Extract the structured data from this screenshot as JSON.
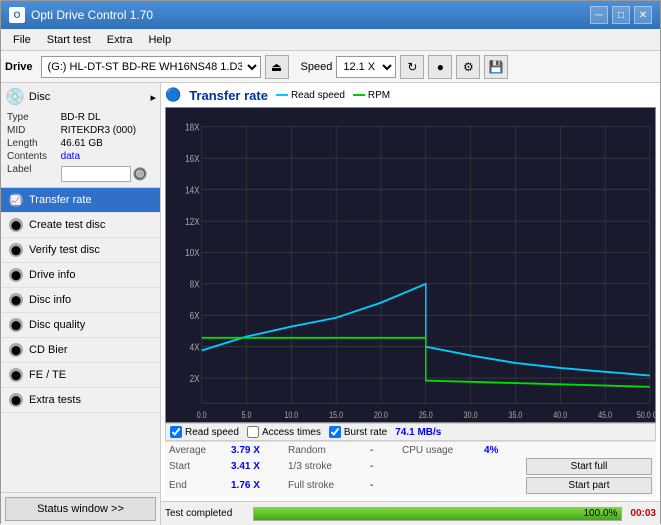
{
  "titlebar": {
    "title": "Opti Drive Control 1.70",
    "min_label": "─",
    "max_label": "□",
    "close_label": "✕"
  },
  "menubar": {
    "items": [
      "File",
      "Start test",
      "Extra",
      "Help"
    ]
  },
  "toolbar": {
    "drive_label": "Drive",
    "drive_value": "(G:)  HL-DT-ST BD-RE  WH16NS48 1.D3",
    "speed_label": "Speed",
    "speed_value": "12.1 X"
  },
  "disc": {
    "type_label": "Type",
    "type_value": "BD-R DL",
    "mid_label": "MID",
    "mid_value": "RITEKDR3 (000)",
    "length_label": "Length",
    "length_value": "46.61 GB",
    "contents_label": "Contents",
    "contents_value": "data",
    "label_label": "Label",
    "label_value": ""
  },
  "nav": {
    "items": [
      {
        "id": "transfer-rate",
        "label": "Transfer rate",
        "active": true
      },
      {
        "id": "create-test-disc",
        "label": "Create test disc",
        "active": false
      },
      {
        "id": "verify-test-disc",
        "label": "Verify test disc",
        "active": false
      },
      {
        "id": "drive-info",
        "label": "Drive info",
        "active": false
      },
      {
        "id": "disc-info",
        "label": "Disc info",
        "active": false
      },
      {
        "id": "disc-quality",
        "label": "Disc quality",
        "active": false
      },
      {
        "id": "cd-bier",
        "label": "CD Bier",
        "active": false
      },
      {
        "id": "fe-te",
        "label": "FE / TE",
        "active": false
      },
      {
        "id": "extra-tests",
        "label": "Extra tests",
        "active": false
      }
    ],
    "status_button": "Status window >>"
  },
  "chart": {
    "title": "Transfer rate",
    "legend": [
      {
        "label": "Read speed",
        "color": "#00ccff"
      },
      {
        "label": "RPM",
        "color": "#00cc00"
      }
    ],
    "y_labels": [
      "18X",
      "16X",
      "14X",
      "12X",
      "10X",
      "8X",
      "6X",
      "4X",
      "2X"
    ],
    "x_labels": [
      "0.0",
      "5.0",
      "10.0",
      "15.0",
      "20.0",
      "25.0",
      "30.0",
      "35.0",
      "40.0",
      "45.0",
      "50.0 GB"
    ],
    "checkboxes": [
      {
        "id": "read-speed",
        "label": "Read speed",
        "checked": true
      },
      {
        "id": "access-times",
        "label": "Access times",
        "checked": false
      },
      {
        "id": "burst-rate",
        "label": "Burst rate",
        "checked": true
      }
    ],
    "burst_rate_value": "74.1 MB/s"
  },
  "stats": {
    "rows": [
      {
        "cells": [
          {
            "type": "lbl",
            "text": "Average"
          },
          {
            "type": "val",
            "text": "3.79 X"
          },
          {
            "type": "lbl",
            "text": "Random"
          },
          {
            "type": "val-dark",
            "text": "-"
          },
          {
            "type": "lbl",
            "text": "CPU usage"
          },
          {
            "type": "pct",
            "text": "4%"
          },
          {
            "type": "empty",
            "text": ""
          }
        ]
      },
      {
        "cells": [
          {
            "type": "lbl",
            "text": "Start"
          },
          {
            "type": "val",
            "text": "3.41 X"
          },
          {
            "type": "lbl",
            "text": "1/3 stroke"
          },
          {
            "type": "val-dark",
            "text": "-"
          },
          {
            "type": "empty",
            "text": ""
          },
          {
            "type": "empty",
            "text": ""
          },
          {
            "type": "btn",
            "text": "Start full"
          }
        ]
      },
      {
        "cells": [
          {
            "type": "lbl",
            "text": "End"
          },
          {
            "type": "val",
            "text": "1.76 X"
          },
          {
            "type": "lbl",
            "text": "Full stroke"
          },
          {
            "type": "val-dark",
            "text": "-"
          },
          {
            "type": "empty",
            "text": ""
          },
          {
            "type": "empty",
            "text": ""
          },
          {
            "type": "btn",
            "text": "Start part"
          }
        ]
      }
    ]
  },
  "statusbar": {
    "status_text": "Test completed",
    "progress_percent": 100,
    "progress_label": "100.0%",
    "time": "00:03"
  }
}
